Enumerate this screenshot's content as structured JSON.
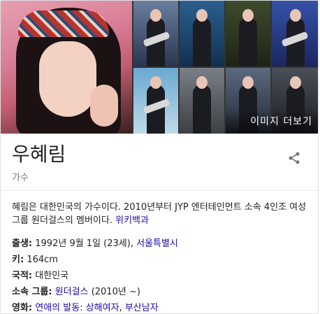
{
  "gallery": {
    "more_images_label": "이미지 더보기"
  },
  "header": {
    "title": "우혜림",
    "subtitle": "가수"
  },
  "description": {
    "text": "혜림은 대한민국의 가수이다. 2010년부터 JYP 엔터테인먼트 소속 4인조 여성 그룹 원더걸스의 멤버이다.",
    "source_link": "위키백과"
  },
  "facts": {
    "birth": {
      "label": "출생",
      "text": "1992년 9월 1일 (23세), ",
      "place": "서울특별시"
    },
    "height": {
      "label": "키",
      "text": "164cm"
    },
    "nationality": {
      "label": "국적",
      "value": "대한민국"
    },
    "group": {
      "label": "소속 그룹",
      "group_name": "원더걸스",
      "years": " (2010년 ~)"
    },
    "films": {
      "label": "영화",
      "items": [
        "연애의 발동: 상해여자",
        "부산남자"
      ],
      "sep": ", "
    }
  },
  "colors": {
    "link": "#1a0dab",
    "text": "#222222",
    "muted": "#777777"
  }
}
